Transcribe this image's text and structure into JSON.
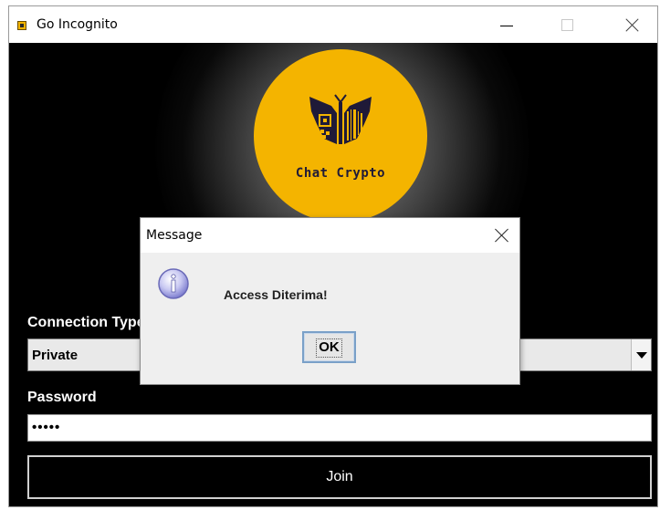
{
  "window": {
    "title": "Go Incognito"
  },
  "logo": {
    "text": "Chat Crypto"
  },
  "form": {
    "connection_type_label": "Connection Type",
    "connection_type_value": "Private",
    "password_label": "Password",
    "password_value": "•••••",
    "join_label": "Join"
  },
  "dialog": {
    "title": "Message",
    "message": "Access Diterima!",
    "ok_label": "OK"
  },
  "colors": {
    "logo_bg": "#f4b400",
    "logo_mark": "#1f1a38",
    "content_bg": "#000000",
    "dialog_bg": "#efefef"
  }
}
